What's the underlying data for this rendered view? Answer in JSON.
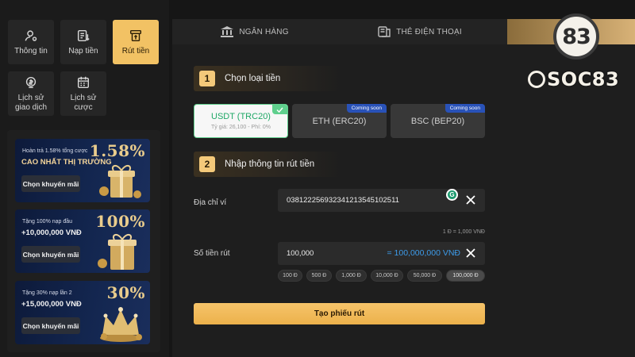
{
  "nav": [
    {
      "label": "Thông tin",
      "icon": "user-settings-icon",
      "active": false
    },
    {
      "label": "Nạp tiền",
      "icon": "deposit-icon",
      "active": false
    },
    {
      "label": "Rút tiền",
      "icon": "withdraw-icon",
      "active": true
    },
    {
      "label": "Lịch sử giao dịch",
      "icon": "transaction-history-icon",
      "active": false
    },
    {
      "label": "Lịch sử cược",
      "icon": "bet-history-icon",
      "active": false
    }
  ],
  "promos": [
    {
      "small": "Hoàn trả 1.58% tổng cược",
      "big": "CAO NHẤT THỊ TRƯỜNG",
      "percent": "1.58%",
      "button": "Chọn khuyến mãi",
      "art": "gift-box-icon"
    },
    {
      "small": "Tặng 100% nạp đầu",
      "big": "+10,000,000 VNĐ",
      "percent": "100%",
      "button": "Chọn khuyến mãi",
      "art": "gift-box-icon"
    },
    {
      "small": "Tặng 30% nạp lần 2",
      "big": "+15,000,000 VNĐ",
      "percent": "30%",
      "button": "Chọn khuyến mãi",
      "art": "crown-icon"
    }
  ],
  "tabs": [
    {
      "label": "NGÂN HÀNG",
      "icon": "bank-icon",
      "active": false
    },
    {
      "label": "THẺ ĐIỆN THOẠI",
      "icon": "phone-card-icon",
      "active": false
    },
    {
      "label": "",
      "icon": "crypto-icon",
      "active": true
    }
  ],
  "step1": {
    "number": "1",
    "title": "Chọn loại tiền"
  },
  "coins": [
    {
      "name": "USDT (TRC20)",
      "rate": "Tỷ giá: 26,100 - Phí: 0%",
      "selected": true,
      "badge": ""
    },
    {
      "name": "ETH (ERC20)",
      "rate": "",
      "selected": false,
      "badge": "Coming soon"
    },
    {
      "name": "BSC (BEP20)",
      "rate": "",
      "selected": false,
      "badge": "Coming soon"
    }
  ],
  "step2": {
    "number": "2",
    "title": "Nhập thông tin rút tiền"
  },
  "wallet": {
    "label": "Địa chỉ ví",
    "value": "0381222569323412135451025​11"
  },
  "amount": {
    "label": "Số tiền rút",
    "value": "100,000",
    "converted": "= 100,000,000 VNĐ",
    "rate_note": "1 Đ = 1,000 VNĐ"
  },
  "quick_amounts": [
    {
      "label": "100 Đ",
      "active": false
    },
    {
      "label": "500 Đ",
      "active": false
    },
    {
      "label": "1,000 Đ",
      "active": false
    },
    {
      "label": "10,000 Đ",
      "active": false
    },
    {
      "label": "50,000 Đ",
      "active": false
    },
    {
      "label": "100,000 Đ",
      "active": true
    }
  ],
  "submit_label": "Tạo phiếu rút",
  "logo": {
    "number": "83",
    "wordmark": "SOC83"
  },
  "colors": {
    "accent": "#f2c264",
    "selected_border": "#5fcf8d",
    "convert_blue": "#3d9be9",
    "coming_soon": "#2952b8"
  }
}
